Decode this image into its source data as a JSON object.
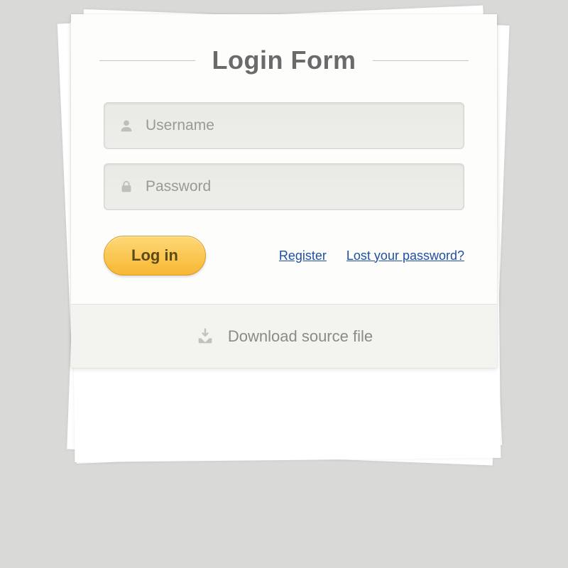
{
  "title": "Login Form",
  "fields": {
    "username": {
      "placeholder": "Username",
      "value": ""
    },
    "password": {
      "placeholder": "Password",
      "value": ""
    }
  },
  "actions": {
    "login_label": "Log in",
    "register_label": "Register",
    "lost_password_label": "Lost your password?"
  },
  "footer": {
    "download_label": "Download source file"
  },
  "colors": {
    "accent": "#f7b733",
    "link": "#1f4f9e"
  }
}
